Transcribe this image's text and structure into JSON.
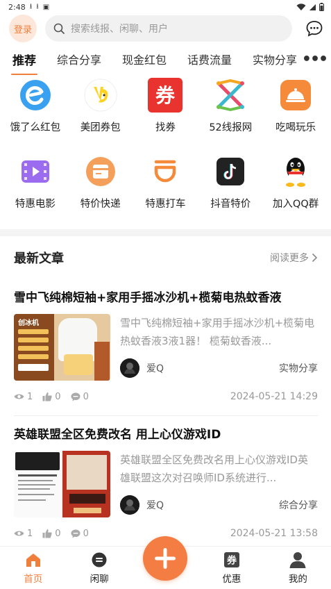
{
  "status_bar": {
    "time": "2:48"
  },
  "header": {
    "login_label": "登录",
    "search_placeholder": "搜索线报、闲聊、用户"
  },
  "tabs": [
    {
      "label": "推荐",
      "active": true
    },
    {
      "label": "综合分享"
    },
    {
      "label": "现金红包"
    },
    {
      "label": "话费流量"
    },
    {
      "label": "实物分享"
    }
  ],
  "quick_links": [
    {
      "label": "饿了么红包",
      "icon": "eleme-icon",
      "color": "#3aa0f0"
    },
    {
      "label": "美团券包",
      "icon": "meituan-icon",
      "color": "#ffd21f"
    },
    {
      "label": "找券",
      "icon": "coupon-icon",
      "color": "#e8332e"
    },
    {
      "label": "52线报网",
      "icon": "52xianbao-icon",
      "color": "#e84c6a"
    },
    {
      "label": "吃喝玩乐",
      "icon": "food-icon",
      "color": "#f58b3a"
    },
    {
      "label": "特惠电影",
      "icon": "film-icon",
      "color": "#9b6cf0"
    },
    {
      "label": "特价快递",
      "icon": "parcel-icon",
      "color": "#f5a05a"
    },
    {
      "label": "特惠打车",
      "icon": "didi-icon",
      "color": "#f58b3a"
    },
    {
      "label": "抖音特价",
      "icon": "douyin-icon",
      "color": "#222222"
    },
    {
      "label": "加入QQ群",
      "icon": "qq-icon",
      "color": "#111111"
    }
  ],
  "articles_section": {
    "title": "最新文章",
    "read_more": "阅读更多"
  },
  "articles": [
    {
      "title": "雪中飞纯棉短袖+家用手摇冰沙机+榄菊电热蚊香液",
      "excerpt": "雪中飞纯棉短袖+家用手摇冰沙机+榄菊电热蚊香液3液1器！ 榄菊蚊香液...",
      "author": "爱Q",
      "category": "实物分享",
      "views": "1",
      "likes": "0",
      "comments": "0",
      "date": "2024-05-21 14:29",
      "thumb_text": "创冰机"
    },
    {
      "title": "英雄联盟全区免费改名 用上心仪游戏ID",
      "excerpt": "英雄联盟全区免费改名用上心仪游戏ID英雄联盟这次对召唤师ID系统进行...",
      "author": "爱Q",
      "category": "综合分享",
      "views": "1",
      "likes": "0",
      "comments": "0",
      "date": "2024-05-21 13:58",
      "thumb_text": ""
    }
  ],
  "bottom_nav": [
    {
      "label": "首页",
      "icon": "home-icon",
      "active": true
    },
    {
      "label": "闲聊",
      "icon": "chat-icon"
    },
    {
      "label": "",
      "icon": "plus-icon"
    },
    {
      "label": "优惠",
      "icon": "coupon-tag-icon"
    },
    {
      "label": "我的",
      "icon": "profile-icon"
    }
  ],
  "colors": {
    "accent": "#f07f3c"
  }
}
